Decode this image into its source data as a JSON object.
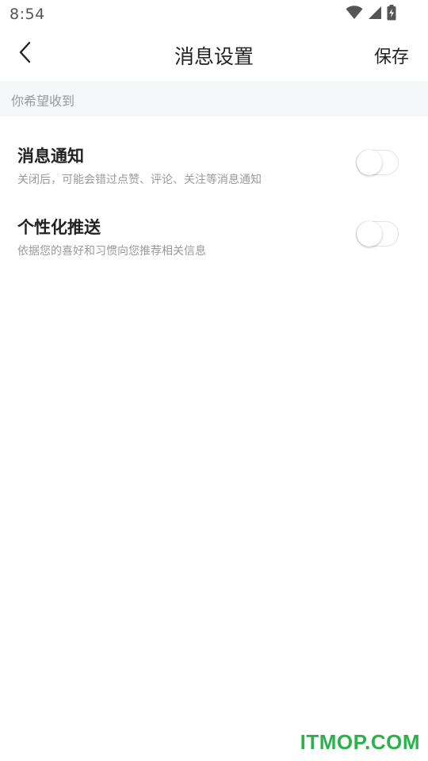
{
  "status_bar": {
    "time": "8:54",
    "icons": [
      "wifi-icon",
      "cell-signal-icon",
      "battery-charging-icon"
    ]
  },
  "header": {
    "back_icon": "chevron-left-icon",
    "title": "消息设置",
    "save_label": "保存"
  },
  "section": {
    "label": "你希望收到"
  },
  "settings": [
    {
      "title": "消息通知",
      "description": "关闭后，可能会错过点赞、评论、关注等消息通知",
      "enabled": false
    },
    {
      "title": "个性化推送",
      "description": "依据您的喜好和习惯向您推荐相关信息",
      "enabled": false
    }
  ],
  "watermark": "ITMOP.COM",
  "colors": {
    "section_background": "#f5f6f8",
    "muted_text": "#9a9a9a",
    "watermark_green": "#2bb24c"
  }
}
